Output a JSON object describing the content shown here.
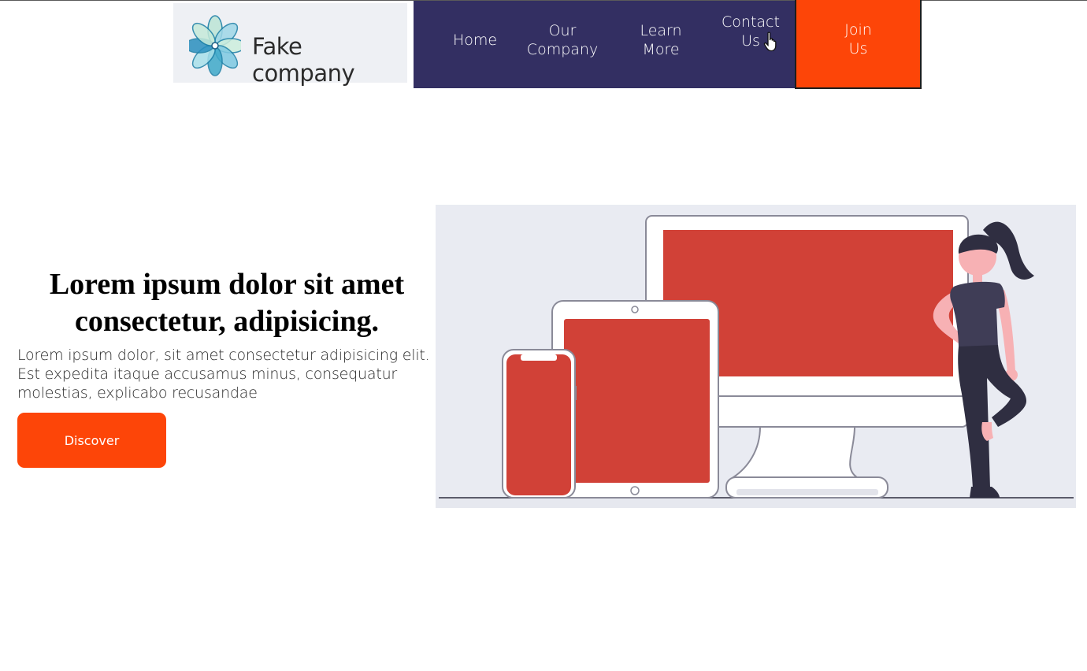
{
  "header": {
    "logo_text": "Fake company",
    "nav": {
      "home": "Home",
      "company_line1": "Our",
      "company_line2": "Company",
      "learn_line1": "Learn",
      "learn_line2": "More",
      "contact_line1": "Contact",
      "contact_line2": "Us"
    },
    "join_line1": "Join",
    "join_line2": "Us"
  },
  "hero": {
    "title_line1": "Lorem ipsum dolor sit amet",
    "title_line2": "consectetur, adipisicing.",
    "text": "Lorem ipsum dolor, sit amet consectetur adipisicing elit. Est expedita itaque accusamus minus, consequatur molestias, explicabo recusandae",
    "button": "Discover"
  },
  "colors": {
    "nav_bg": "#332f62",
    "accent": "#fd4508",
    "screen_red": "#d14137",
    "illustration_bg": "#e9ebf2"
  },
  "icons": [
    "logo-flower-icon",
    "hand-pointer-cursor-icon"
  ]
}
